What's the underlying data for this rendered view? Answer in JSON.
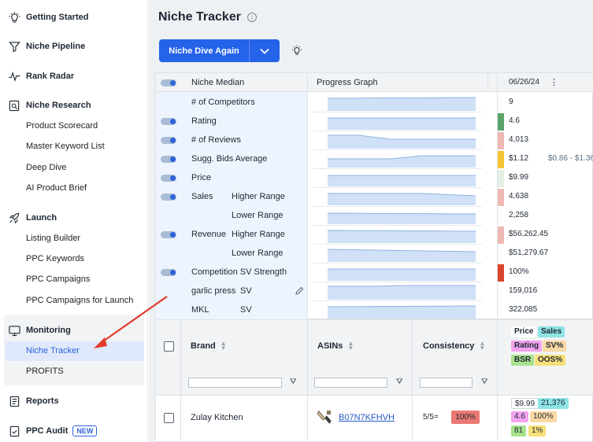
{
  "sidebar": {
    "sections": [
      {
        "label": "Getting Started",
        "icon": "bulb-icon"
      },
      {
        "label": "Niche Pipeline",
        "icon": "funnel-icon"
      },
      {
        "label": "Rank Radar",
        "icon": "pulse-icon"
      },
      {
        "label": "Niche Research",
        "icon": "research-icon"
      },
      {
        "label": "Launch",
        "icon": "rocket-icon"
      },
      {
        "label": "Monitoring",
        "icon": "monitor-icon"
      },
      {
        "label": "Reports",
        "icon": "document-icon"
      },
      {
        "label": "PPC Audit",
        "icon": "audit-icon",
        "badge": "NEW"
      }
    ],
    "niche_research_items": [
      "Product Scorecard",
      "Master Keyword List",
      "Deep Dive",
      "AI Product Brief"
    ],
    "launch_items": [
      "Listing Builder",
      "PPC Keywords",
      "PPC Campaigns",
      "PPC Campaigns for Launch"
    ],
    "monitoring_items": [
      "Niche Tracker",
      "PROFITS"
    ],
    "active_item": "Niche Tracker"
  },
  "header": {
    "title": "Niche Tracker",
    "info_icon": "info-icon",
    "primary_button": "Niche Dive Again",
    "bulb_icon": "bulb-icon"
  },
  "metrics": {
    "col_niche_median": "Niche Median",
    "col_progress": "Progress Graph",
    "col_date": "06/26/24",
    "rows": [
      {
        "label": "# of Competitors",
        "sub": "",
        "value": "9",
        "toggle": false,
        "bar_color": ""
      },
      {
        "label": "Rating",
        "sub": "",
        "value": "4.6",
        "toggle": true,
        "bar_color": "#5aa469"
      },
      {
        "label": "# of Reviews",
        "sub": "",
        "value": "4,013",
        "toggle": true,
        "bar_color": "#f0b9b5"
      },
      {
        "label": "Sugg. Bids Average",
        "sub": "",
        "value": "$1.12",
        "extra": "$0.86 - $1.36",
        "toggle": true,
        "bar_color": "#f5c531"
      },
      {
        "label": "Price",
        "sub": "",
        "value": "$9.99",
        "toggle": true,
        "bar_color": "#e4efe5"
      },
      {
        "label": "Sales",
        "sub": "Higher Range",
        "value": "4,638",
        "toggle": true,
        "bar_color": "#f0b9b5"
      },
      {
        "label": "",
        "sub": "Lower Range",
        "value": "2,258",
        "toggle": false,
        "bar_color": ""
      },
      {
        "label": "Revenue",
        "sub": "Higher Range",
        "value": "$56,262.45",
        "toggle": true,
        "bar_color": "#f0b9b5"
      },
      {
        "label": "",
        "sub": "Lower Range",
        "value": "$51,279.67",
        "toggle": false,
        "bar_color": ""
      },
      {
        "label": "Competition SV Strength",
        "sub": "",
        "value": "100%",
        "toggle": true,
        "bar_color": "#d9442b"
      },
      {
        "label": "garlic press",
        "sub": "SV",
        "value": "159,016",
        "toggle": false,
        "bar_color": ""
      },
      {
        "label": "MKL",
        "sub": "SV",
        "value": "322,085",
        "toggle": false,
        "bar_color": ""
      }
    ]
  },
  "table": {
    "columns": {
      "brand": "Brand",
      "asins": "ASINs",
      "consistency": "Consistency"
    },
    "metric_pills": [
      {
        "label": "Price",
        "color": "#ffffff"
      },
      {
        "label": "Sales",
        "color": "#8ee4e4"
      },
      {
        "label": "Rating",
        "color": "#f3a3ef"
      },
      {
        "label": "SV%",
        "color": "#fbd9a5"
      },
      {
        "label": "BSR",
        "color": "#a7e28c"
      },
      {
        "label": "OOS%",
        "color": "#f7e07a"
      }
    ],
    "rows": [
      {
        "brand": "Zulay Kitchen",
        "asin": "B07N7KFHVH",
        "consistency": "5/5=",
        "consistency_pct": "100%",
        "metrics": [
          "$9.99",
          "21,376",
          "4.6",
          "100%",
          "81",
          "1%"
        ]
      }
    ]
  }
}
